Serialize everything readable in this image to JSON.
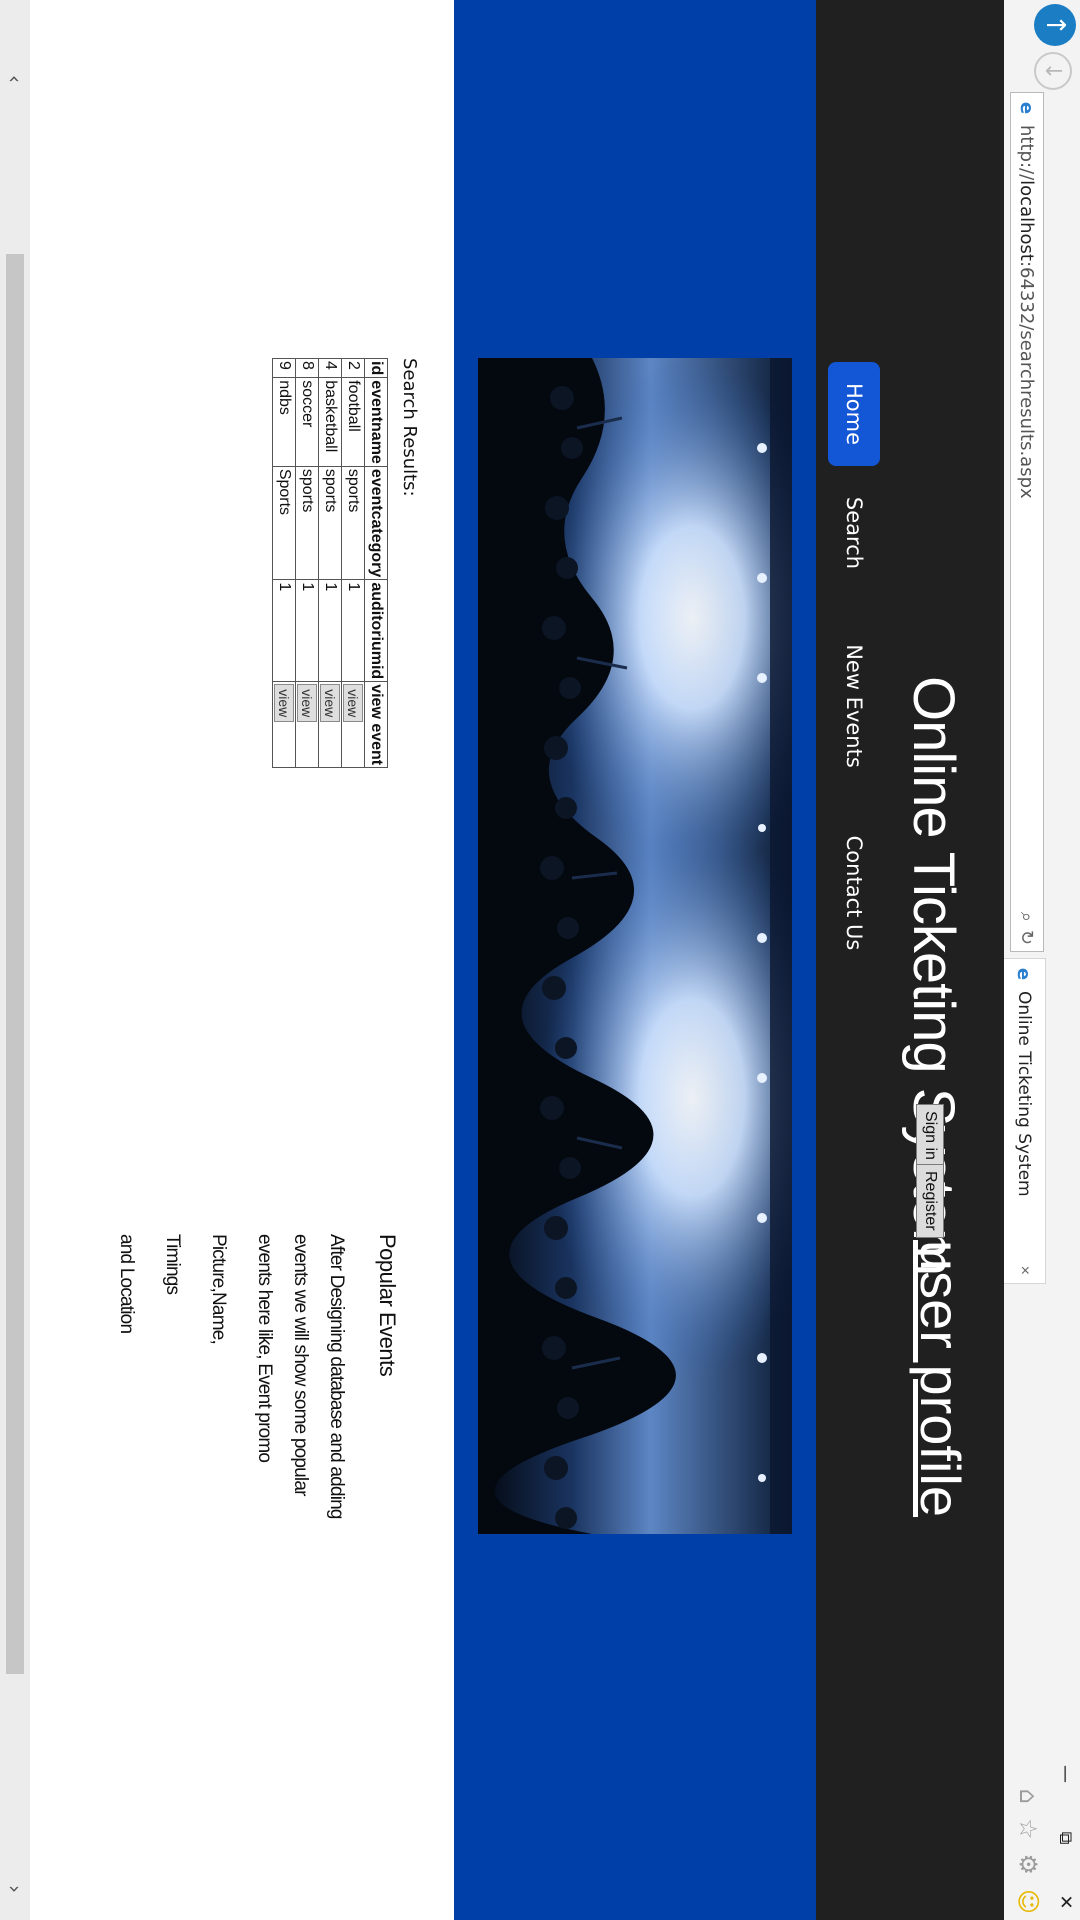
{
  "browser": {
    "address_scheme": "http://",
    "address_host": "localhost",
    "address_rest": ":64332/searchresults.aspx",
    "tab_title": "Online Ticketing System",
    "tab_close": "×",
    "back_glyph": "↑",
    "forward_glyph": "↓",
    "search_glyph": "⌕",
    "refresh_glyph": "↻",
    "minimize_glyph": "—",
    "restore_glyph": "⧉",
    "close_glyph": "✕",
    "home_glyph": "⌂",
    "star_glyph": "☆",
    "gear_glyph": "⚙",
    "smile_glyph": "☺",
    "scroll_left": "‹",
    "scroll_right": "›"
  },
  "header": {
    "brand": "Online Ticketing System",
    "signin_label": "Sign in",
    "register_label": "Register",
    "user_profile": "user profile"
  },
  "nav": {
    "home": "Home",
    "search": "Search",
    "new_events": "New Events",
    "contact": "Contact Us"
  },
  "results": {
    "heading": "Search Results:",
    "columns": [
      "id",
      "eventname",
      "eventcategory",
      "auditoriumid",
      "view event"
    ],
    "rows": [
      {
        "id": "2",
        "eventname": "football",
        "eventcategory": "sports",
        "auditoriumid": "1",
        "view": "view"
      },
      {
        "id": "4",
        "eventname": "basketball",
        "eventcategory": "sports",
        "auditoriumid": "1",
        "view": "view"
      },
      {
        "id": "8",
        "eventname": "soccer",
        "eventcategory": "sports",
        "auditoriumid": "1",
        "view": "view"
      },
      {
        "id": "9",
        "eventname": "ndbs",
        "eventcategory": "Sports",
        "auditoriumid": "1",
        "view": "view"
      }
    ]
  },
  "popular": {
    "title": "Popular Events",
    "lines": [
      "After Designing database and adding",
      "events we will show some popular",
      "events here like, Event promo",
      "Picture,Name,",
      "Timings",
      "and Location"
    ]
  },
  "colors": {
    "header_bg": "#202020",
    "hero_bg": "#003fa8",
    "nav_active": "#1356d6"
  }
}
